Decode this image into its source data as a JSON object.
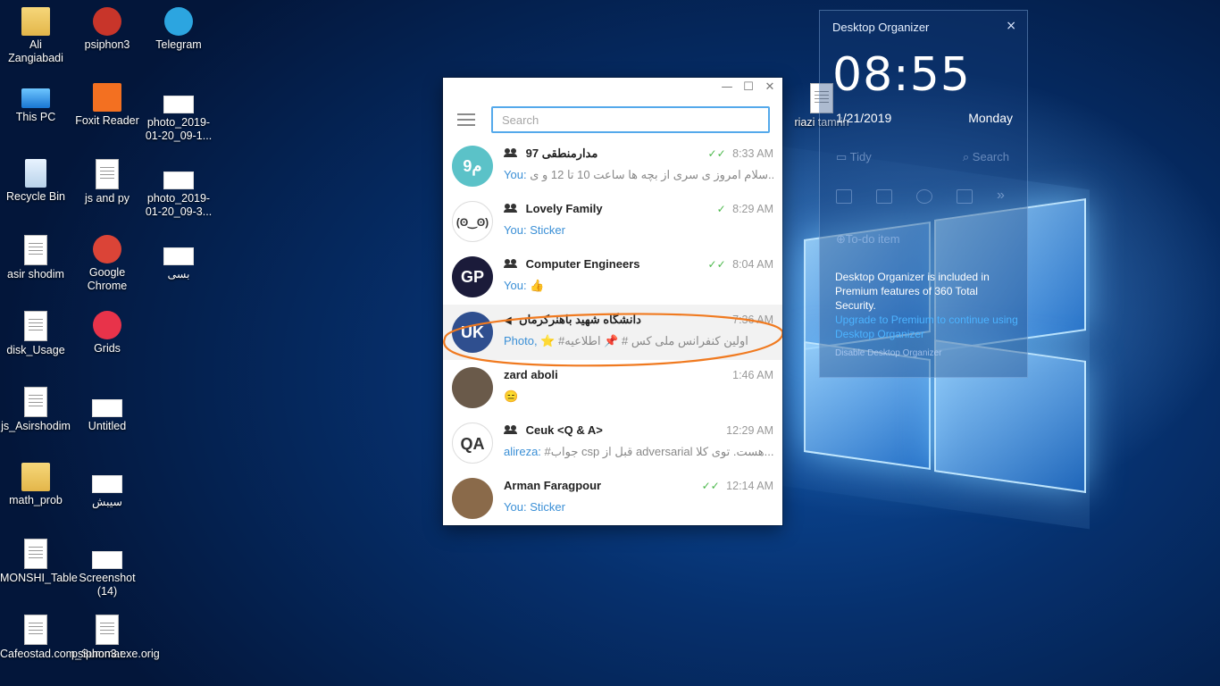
{
  "desktop_icons": [
    {
      "label": "Ali\nZangiabadi",
      "icon": "folder-icon"
    },
    {
      "label": "psiphon3",
      "icon": "psiphon-icon"
    },
    {
      "label": "Telegram",
      "icon": "telegram-icon"
    },
    {
      "label": "This PC",
      "icon": "computer-icon"
    },
    {
      "label": "Foxit Reader",
      "icon": "pdf-icon"
    },
    {
      "label": "photo_2019-01-20_09-1...",
      "icon": "image-icon"
    },
    {
      "label": "Recycle Bin",
      "icon": "recycle-bin-icon"
    },
    {
      "label": "js and py",
      "icon": "document-icon"
    },
    {
      "label": "photo_2019-01-20_09-3...",
      "icon": "image-icon"
    },
    {
      "label": "asir shodim",
      "icon": "document-icon"
    },
    {
      "label": "Google Chrome",
      "icon": "chrome-icon"
    },
    {
      "label": "بسی",
      "icon": "image-icon"
    },
    {
      "label": "disk_Usage",
      "icon": "document-icon"
    },
    {
      "label": "Grids",
      "icon": "grids-icon"
    },
    {
      "label": "js_Asirshodim",
      "icon": "document-icon"
    },
    {
      "label": "Untitled",
      "icon": "image-icon"
    },
    {
      "label": "math_prob",
      "icon": "folder-icon"
    },
    {
      "label": "سیبش",
      "icon": "image-icon"
    },
    {
      "label": "MONSHI_Table",
      "icon": "document-icon"
    },
    {
      "label": "Screenshot (14)",
      "icon": "image-icon"
    },
    {
      "label": "Cafeostad.com_Summar...",
      "icon": "installer-icon"
    },
    {
      "label": "psiphon3.exe.orig",
      "icon": "file-icon"
    },
    {
      "label": "riazi tamrin",
      "icon": "document-icon"
    }
  ],
  "telegram": {
    "window_controls": {
      "minimize": "—",
      "maximize": "☐",
      "close": "✕"
    },
    "search": {
      "placeholder": "Search",
      "value": ""
    },
    "chats": [
      {
        "name": "مدارمنطقی 97",
        "group": true,
        "time": "8:33 AM",
        "read": "✓✓",
        "sender": "You:",
        "message": "سلام امروز ی سری از بچه ها ساعت 10 تا 12 و ی...",
        "avatar_text": "م9",
        "avatar_color": "#5bc2c8"
      },
      {
        "name": "Lovely Family",
        "group": true,
        "time": "8:29 AM",
        "read": "✓",
        "sender": "You:",
        "message": "Sticker",
        "avatar_text": "(ʘ‿ʘ)",
        "avatar_color": "#ffffff"
      },
      {
        "name": "Computer Engineers",
        "group": true,
        "time": "8:04 AM",
        "read": "✓✓",
        "sender": "You:",
        "message": "👍",
        "avatar_text": "GP",
        "avatar_color": "#1b1b3a"
      },
      {
        "name": "دانشگاه شهید باهنرکرمان",
        "group": false,
        "channel": true,
        "time": "7:36 AM",
        "read": "",
        "sender": "Photo,",
        "message": "⭐ #اولین کنفرانس ملی کس # 📌 اطلاعیه",
        "avatar_text": "UK",
        "avatar_color": "#2f4f8f"
      },
      {
        "name": "zard aboli",
        "group": false,
        "time": "1:46 AM",
        "read": "",
        "sender": "",
        "message": "😑",
        "avatar_text": "",
        "avatar_color": "#6a5a4a"
      },
      {
        "name": "Ceuk <Q & A>",
        "group": true,
        "time": "12:29 AM",
        "read": "",
        "sender": "alireza:",
        "message": "#جواب csp قبل از adversarial هست. توی کلا...",
        "avatar_text": "QA",
        "avatar_color": "#ffffff"
      },
      {
        "name": "Arman Faragpour",
        "group": false,
        "time": "12:14 AM",
        "read": "✓✓",
        "sender": "You:",
        "message": "Sticker",
        "avatar_text": "",
        "avatar_color": "#8a6a4a"
      }
    ]
  },
  "organizer": {
    "title": "Desktop Organizer",
    "close": "×",
    "time": "08:55",
    "date": "1/21/2019",
    "day": "Monday",
    "tidy": "Tidy",
    "search": "Search",
    "todo": "To-do item",
    "info": "Desktop Organizer is included in Premium features of 360 Total Security.",
    "upgrade": "Upgrade to Premium to continue using Desktop Organizer",
    "disable": "Disable Desktop Organizer"
  },
  "colors": {
    "accent": "#54a9eb",
    "link": "#3a8fd6",
    "annotation": "#f07a20",
    "read_check": "#4cb84c"
  }
}
